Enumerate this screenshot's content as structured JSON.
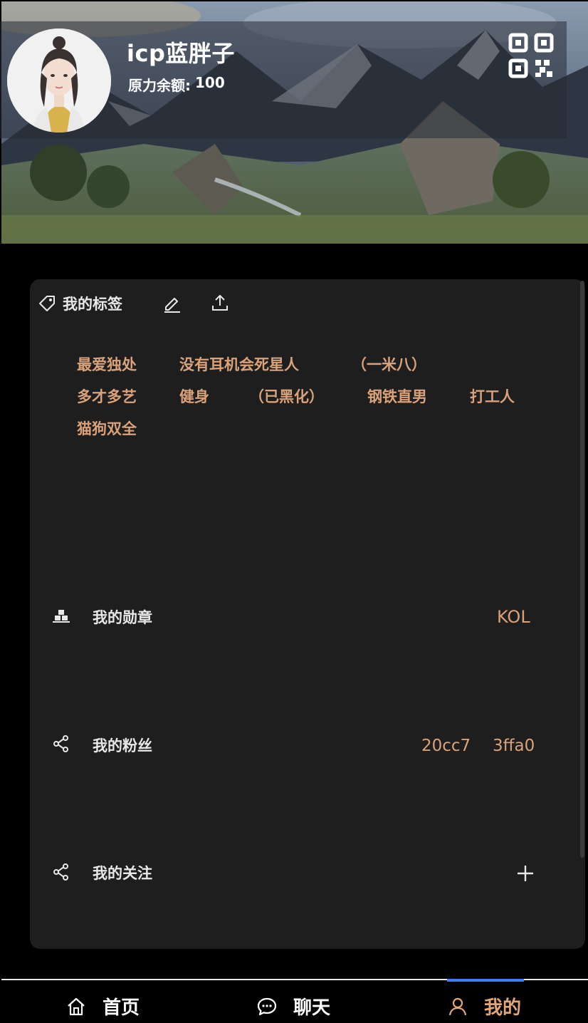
{
  "profile": {
    "username": "icp蓝胖子",
    "balance_label": "原力余额:",
    "balance_value": "100"
  },
  "tags_section": {
    "title": "我的标签",
    "tags": [
      "最爱独处",
      "没有耳机会死星人",
      "（一米八）",
      "多才多艺",
      "健身",
      "（已黑化）",
      "钢铁直男",
      "打工人",
      "猫狗双全"
    ]
  },
  "medals": {
    "label": "我的勋章",
    "value": "KOL"
  },
  "fans": {
    "label": "我的粉丝",
    "values": [
      "20cc7",
      "3ffa0"
    ]
  },
  "following": {
    "label": "我的关注"
  },
  "nav": {
    "items": [
      {
        "label": "首页"
      },
      {
        "label": "聊天"
      },
      {
        "label": "我的"
      }
    ],
    "active_index": 2
  },
  "colors": {
    "accent": "#d9a27a",
    "card_bg": "#1e1e1e",
    "page_bg": "#000000",
    "nav_indicator": "#3b82f6"
  }
}
